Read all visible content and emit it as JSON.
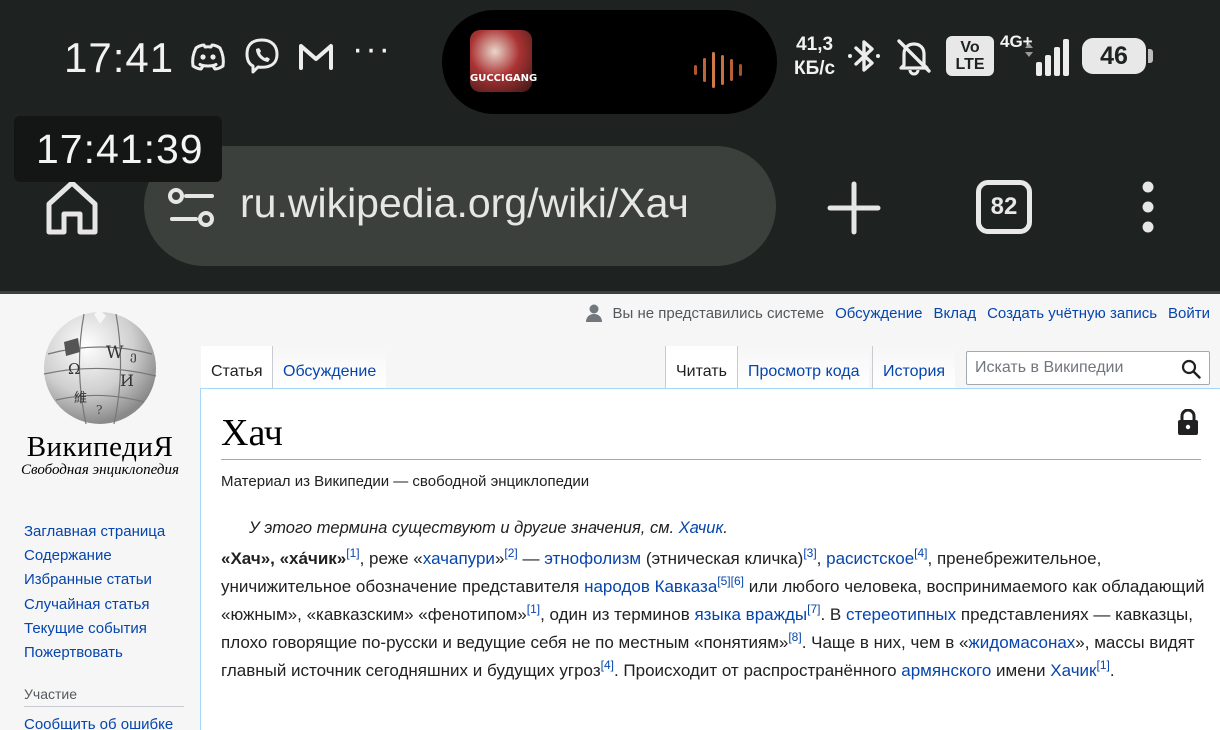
{
  "status_bar": {
    "time": "17:41",
    "net_speed_value": "41,3",
    "net_speed_unit": "КБ/с",
    "volte_line1": "Vo",
    "volte_line2": "LTE",
    "network_type": "4G+",
    "battery": "46",
    "overflow": "···",
    "now_playing_art_text": "GUCCIGANG",
    "icons": [
      "discord-icon",
      "viber-icon",
      "gmail-icon",
      "bluetooth-icon",
      "bell-off-icon",
      "signal-icon"
    ]
  },
  "clock_overlay": "17:41:39",
  "browser": {
    "url": "ru.wikipedia.org/wiki/Хач",
    "tab_count": "82"
  },
  "wiki": {
    "logo_word": "ВикипедиЯ",
    "logo_tagline": "Свободная энциклопедия",
    "sidebar": {
      "items": [
        "Заглавная страница",
        "Содержание",
        "Избранные статьи",
        "Случайная статья",
        "Текущие события",
        "Пожертвовать"
      ],
      "section_heading": "Участие",
      "report_link": "Сообщить об ошибке"
    },
    "personal": {
      "not_logged": "Вы не представились системе",
      "talk": "Обсуждение",
      "contributions": "Вклад",
      "create_account": "Создать учётную запись",
      "login": "Войти"
    },
    "tabs": {
      "article": "Статья",
      "talk": "Обсуждение",
      "read": "Читать",
      "view_source": "Просмотр кода",
      "history": "История"
    },
    "search": {
      "placeholder": "Искать в Википедии"
    },
    "title": "Хач",
    "tagline": "Материал из Википедии — свободной энциклопедии",
    "hatnote": {
      "prefix": "У этого термина существуют и другие значения, см. ",
      "link": "Хачик",
      "suffix": "."
    },
    "para": {
      "t1": "«Хач», «ха́чик»",
      "r1": "[1]",
      "t2": ", реже «",
      "l_khachapuri": "хачапури",
      "t3": "»",
      "r2": "[2]",
      "t4": " — ",
      "l_ethnophaulism": "этнофолизм",
      "t5": " (этническая кличка)",
      "r3": "[3]",
      "t6": ", ",
      "l_racist": "расистское",
      "r4": "[4]",
      "t7": ", пренебрежительное, уничижительное обозначение представителя ",
      "l_caucasus": "народов Кавказа",
      "r5": "[5]",
      "r6": "[6]",
      "t8": " или любого человека, воспринимаемого как обладающий «южным», «кавказским» «фенотипом»",
      "r1b": "[1]",
      "t9": ", один из терминов ",
      "l_hate": "языка вражды",
      "r7": "[7]",
      "t10": ". В ",
      "l_stereo": "стереотипных",
      "t11": " представлениях — кавказцы, плохо говорящие по-русски и ведущие себя не по местным «понятиям»",
      "r8": "[8]",
      "t12": ". Чаще в них, чем в «",
      "l_zhido": "жидомасонах",
      "t13": "», массы видят главный источник сегодняшних и будущих угроз",
      "r4b": "[4]",
      "t14": ". Происходит от распространённого ",
      "l_armenian": "армянского",
      "t15": " имени ",
      "l_khachik": "Хачик",
      "r1c": "[1]",
      "t16": "."
    }
  }
}
